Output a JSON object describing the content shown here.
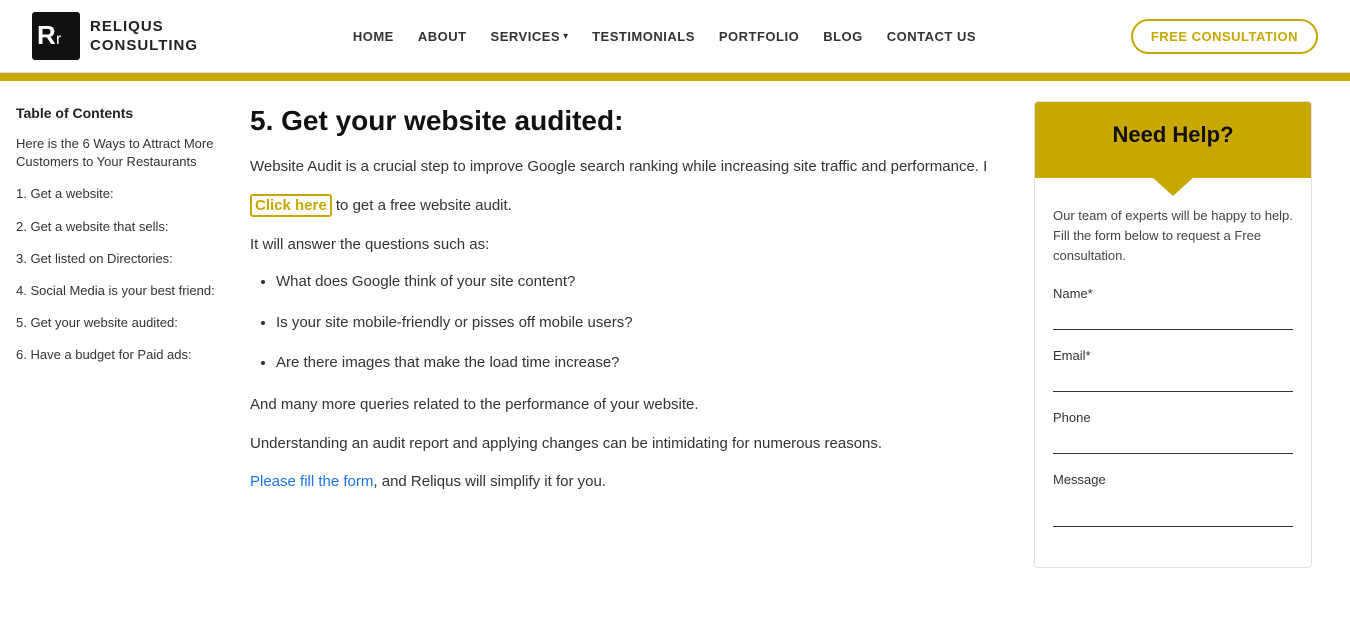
{
  "header": {
    "logo_line1": "RELIQUS",
    "logo_line2": "CONSULTING",
    "nav_items": [
      {
        "label": "HOME",
        "href": "#"
      },
      {
        "label": "ABOUT",
        "href": "#"
      },
      {
        "label": "SERVICES",
        "href": "#",
        "has_dropdown": true
      },
      {
        "label": "TESTIMONIALS",
        "href": "#"
      },
      {
        "label": "PORTFOLIO",
        "href": "#"
      },
      {
        "label": "BLOG",
        "href": "#"
      },
      {
        "label": "CONTACT US",
        "href": "#"
      }
    ],
    "cta_label": "FREE CONSULTATION"
  },
  "sidebar_toc": {
    "title": "Table of Contents",
    "items": [
      {
        "label": "Here is the 6 Ways to Attract More Customers to Your Restaurants"
      },
      {
        "label": "1. Get a website:"
      },
      {
        "label": "2. Get a website that sells:"
      },
      {
        "label": "3. Get listed on Directories:"
      },
      {
        "label": "4. Social Media is your best friend:"
      },
      {
        "label": "5. Get your website audited:"
      },
      {
        "label": "6. Have a budget for Paid ads:"
      }
    ]
  },
  "content": {
    "section_number": "5.",
    "section_title": "Get your website audited:",
    "intro": "Website Audit is a crucial step to improve Google search ranking while increasing site traffic and performance. I",
    "click_here_label": "Click here",
    "click_here_suffix": " to get a free website audit.",
    "answer_line": "It will answer the questions such as:",
    "bullets": [
      "What does Google think of your site content?",
      "Is your site mobile-friendly or pisses off mobile users?",
      "Are there images that make the load time increase?"
    ],
    "many_more": "And many more queries related to the performance of your website.",
    "understanding_line": "Understanding an audit report and applying changes can be intimidating for numerous reasons.",
    "please_label": "Please fill the form",
    "please_suffix": ", and Reliqus will simplify it for you."
  },
  "form_sidebar": {
    "header_title": "Need Help?",
    "body_text": "Our team of experts will be happy to help. Fill the form below to request a Free consultation.",
    "fields": [
      {
        "label": "Name*",
        "type": "text",
        "name": "name"
      },
      {
        "label": "Email*",
        "type": "email",
        "name": "email"
      },
      {
        "label": "Phone",
        "type": "text",
        "name": "phone"
      },
      {
        "label": "Message",
        "type": "textarea",
        "name": "message"
      }
    ]
  }
}
